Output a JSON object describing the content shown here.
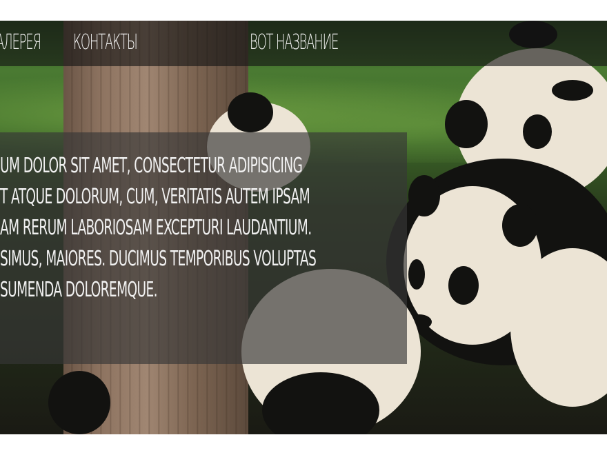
{
  "nav": {
    "items": [
      {
        "label": "АЛЕРЕЯ"
      },
      {
        "label": "КОНТАКТЫ"
      }
    ],
    "title": "ВОТ НАЗВАНИЕ"
  },
  "hero": {
    "image_subject": "pandas-on-tree",
    "text_lines": [
      "UM DOLOR SIT AMET, CONSECTETUR ADIPISICING",
      "T ATQUE DOLORUM, CUM, VERITATIS AUTEM IPSAM",
      "AM RERUM LABORIOSAM EXCEPTURI LAUDANTIUM.",
      "SIMUS, MAIORES. DUCIMUS TEMPORIBUS VOLUPTAS",
      "SUMENDA DOLOREMQUE."
    ]
  },
  "colors": {
    "nav_overlay": "#141414",
    "panel_overlay": "#373737",
    "text": "#f1f1f1"
  }
}
